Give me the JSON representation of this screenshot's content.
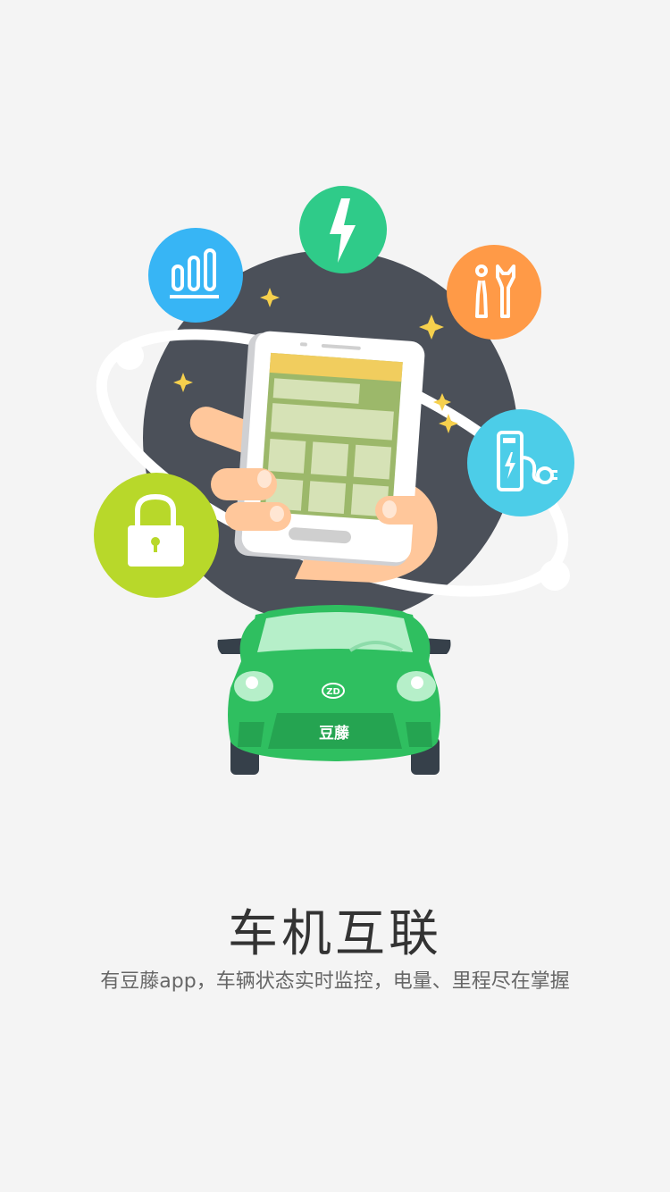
{
  "colors": {
    "background": "#f4f4f4",
    "dark_circle": "#4b5059",
    "stats": "#37b5f5",
    "power": "#2fcb89",
    "tools": "#ff9a47",
    "charging": "#4ccde8",
    "lock": "#b8d82a",
    "car": "#2fbf60"
  },
  "icons": [
    "bar-chart-icon",
    "lightning-icon",
    "tools-icon",
    "charging-pile-icon",
    "lock-icon"
  ],
  "car": {
    "logo": "ZD",
    "plate": "豆藤"
  },
  "onboarding": {
    "title": "车机互联",
    "subtitle": "有豆藤app，车辆状态实时监控，电量、里程尽在掌握"
  }
}
